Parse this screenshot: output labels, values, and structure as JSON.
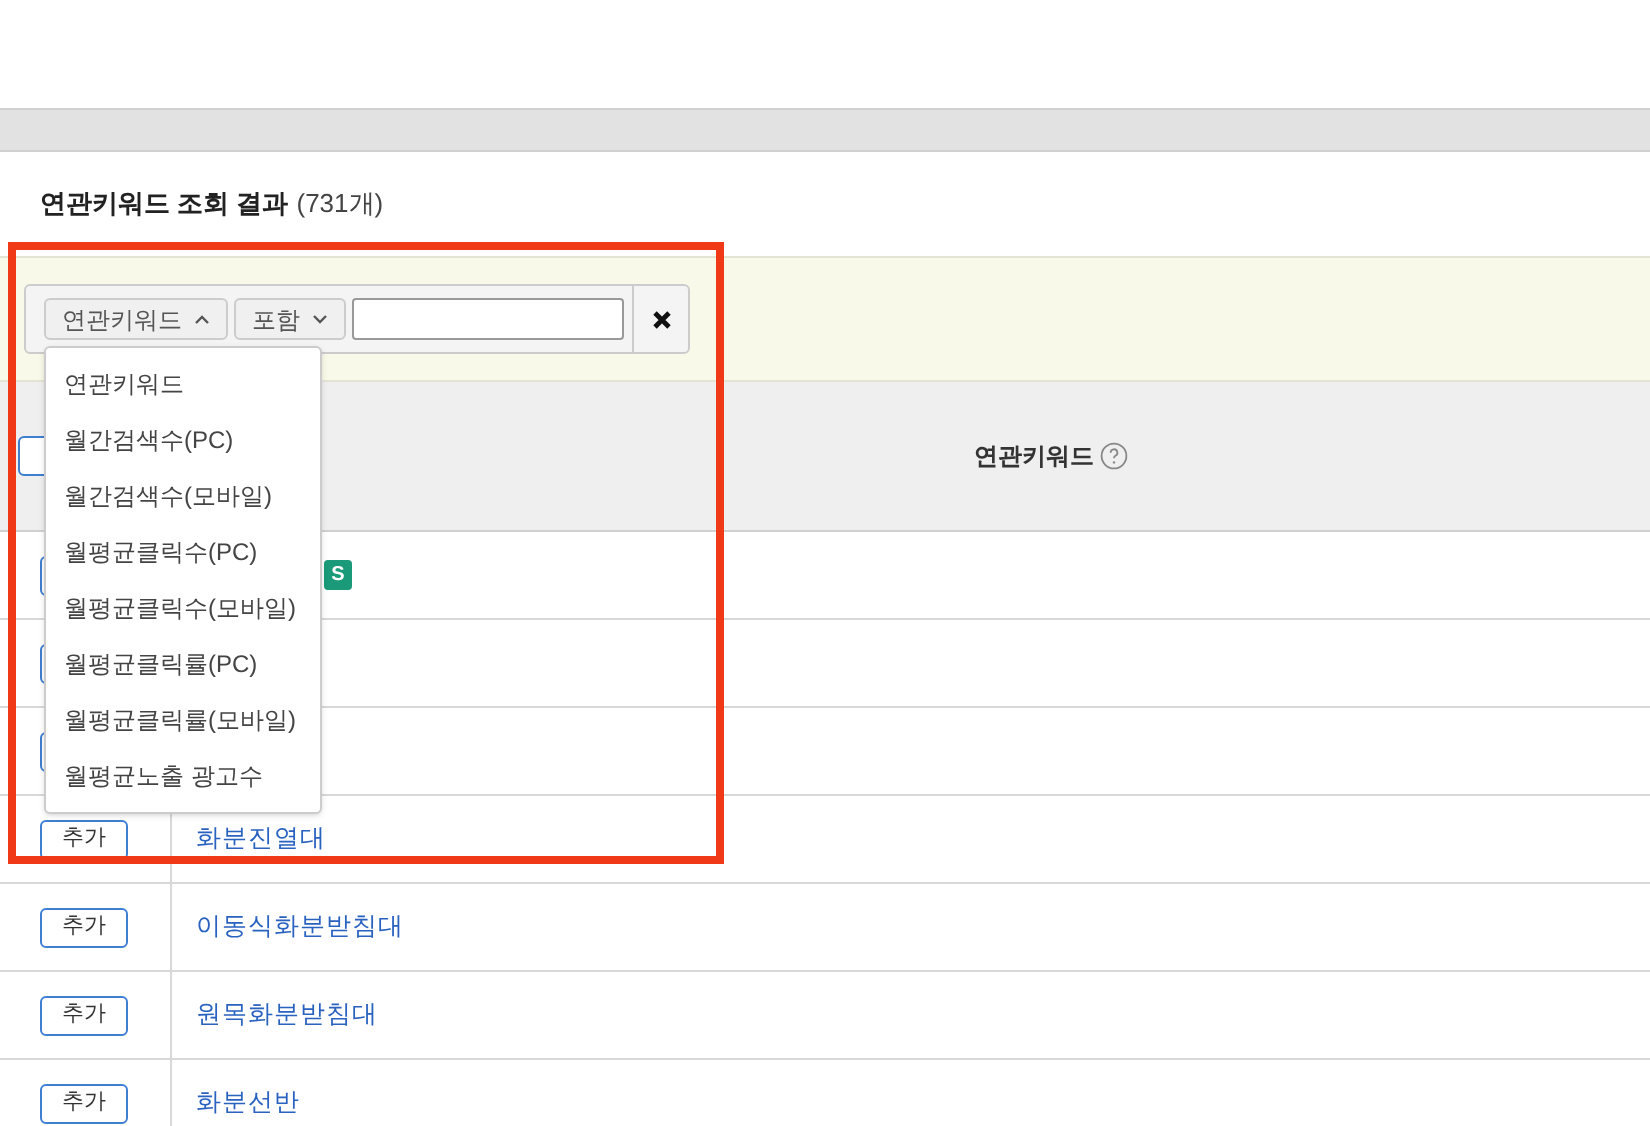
{
  "section_title": {
    "label": "연관키워드 조회 결과",
    "count": "(731개)"
  },
  "filter": {
    "field_select": "연관키워드",
    "field_open": true,
    "operator_select": "포함",
    "operator_open": false
  },
  "field_options": [
    {
      "label": "연관키워드"
    },
    {
      "label": "월간검색수(PC)"
    },
    {
      "label": "월간검색수(모바일)"
    },
    {
      "label": "월평균클릭수(PC)"
    },
    {
      "label": "월평균클릭수(모바일)"
    },
    {
      "label": "월평균클릭률(PC)"
    },
    {
      "label": "월평균클릭률(모바일)"
    },
    {
      "label": "월평균노출 광고수"
    }
  ],
  "table": {
    "columns": [
      "연관키워드"
    ],
    "rows": [
      {
        "badge": "S"
      },
      {},
      {},
      {
        "button": "추가",
        "keyword": "화분진열대"
      },
      {
        "button": "추가",
        "keyword": "이동식화분받침대"
      },
      {
        "button": "추가",
        "keyword": "원목화분받침대"
      },
      {
        "button": "추가",
        "keyword": "화분선반"
      }
    ]
  }
}
